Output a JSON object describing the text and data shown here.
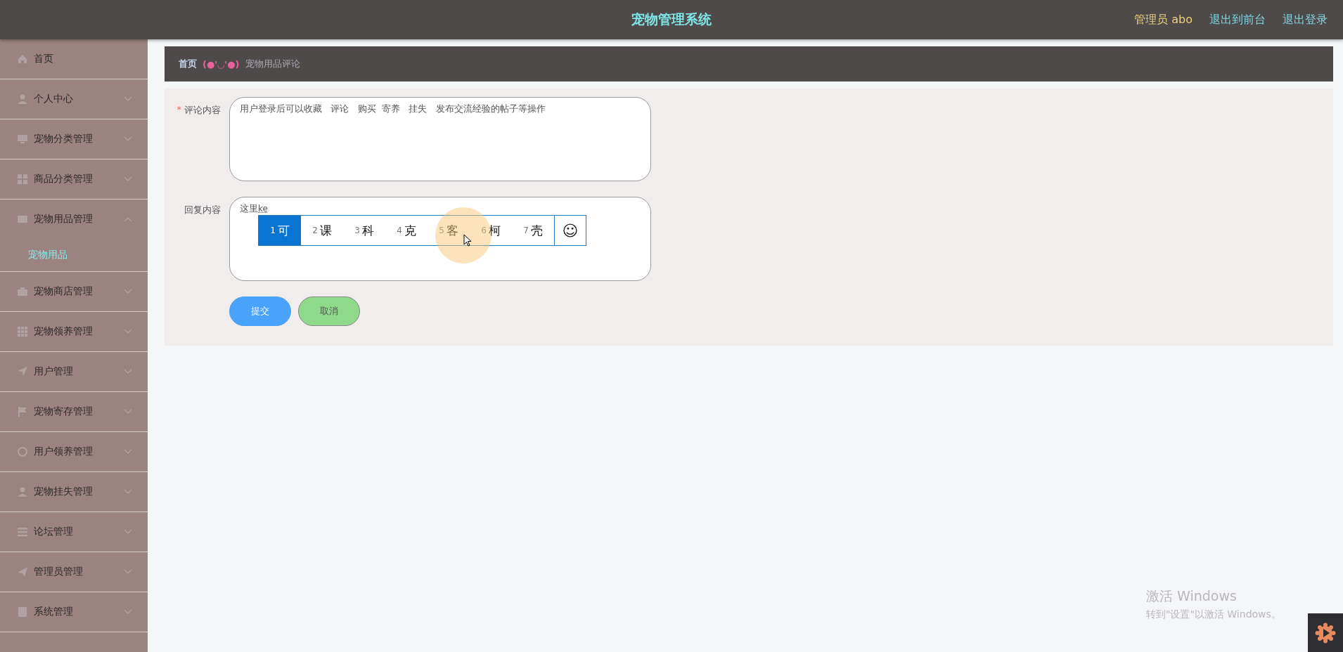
{
  "header": {
    "title": "宠物管理系统",
    "user": "管理员 abo",
    "links": [
      "退出到前台",
      "退出登录"
    ]
  },
  "sidebar": {
    "items": [
      {
        "label": "首页"
      },
      {
        "label": "个人中心",
        "expanded": false
      },
      {
        "label": "宠物分类管理",
        "expanded": false
      },
      {
        "label": "商品分类管理",
        "expanded": false
      },
      {
        "label": "宠物用品管理",
        "expanded": true,
        "children": [
          {
            "label": "宠物用品",
            "selected": true
          }
        ]
      },
      {
        "label": "宠物商店管理",
        "expanded": false
      },
      {
        "label": "宠物领养管理",
        "expanded": false
      },
      {
        "label": "用户管理",
        "expanded": false
      },
      {
        "label": "宠物寄存管理",
        "expanded": false
      },
      {
        "label": "用户领养管理",
        "expanded": false
      },
      {
        "label": "宠物挂失管理",
        "expanded": false
      },
      {
        "label": "论坛管理",
        "expanded": false
      },
      {
        "label": "管理员管理",
        "expanded": false
      },
      {
        "label": "系统管理",
        "expanded": false
      }
    ]
  },
  "breadcrumb": {
    "home": "首页",
    "emoticon": "(●'◡'●)",
    "current": "宠物用品评论"
  },
  "form": {
    "fields": [
      {
        "label": "评论内容",
        "required_mark": "*",
        "value": "用户登录后可以收藏   评论   购买  寄养   挂失   发布交流经验的帖子等操作"
      },
      {
        "label": "回复内容",
        "value": "这里",
        "composition": "ke"
      }
    ],
    "buttons": [
      {
        "label": "提交",
        "kind": "primary"
      },
      {
        "label": "取消",
        "kind": "secondary"
      }
    ]
  },
  "ime": {
    "candidates": [
      {
        "number": "1",
        "text": "可",
        "selected": true
      },
      {
        "number": "2",
        "text": "课",
        "selected": false
      },
      {
        "number": "3",
        "text": "科",
        "selected": false
      },
      {
        "number": "4",
        "text": "克",
        "selected": false
      },
      {
        "number": "5",
        "text": "客",
        "selected": false
      },
      {
        "number": "6",
        "text": "柯",
        "selected": false
      },
      {
        "number": "7",
        "text": "壳",
        "selected": false
      }
    ],
    "emoji": "☺"
  },
  "activation": {
    "title": "激活 Windows",
    "subtitle": "转到\"设置\"以激活 Windows。"
  }
}
